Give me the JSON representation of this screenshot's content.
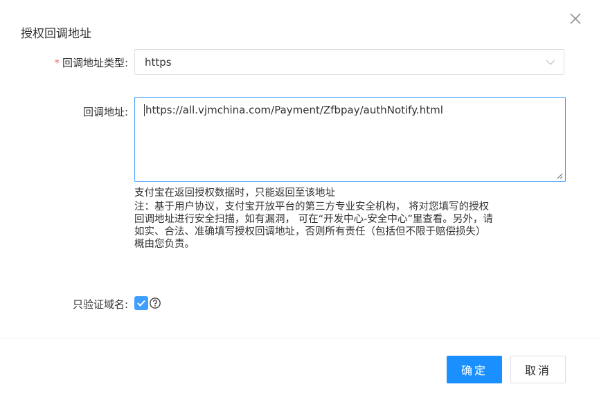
{
  "dialog": {
    "title": "授权回调地址"
  },
  "form": {
    "required_mark": "*",
    "type_label": "回调地址类型:",
    "type_value": "https",
    "address_label": "回调地址:",
    "address_value": "https://all.vjmchina.com/Payment/Zfbpay/authNotify.html",
    "hint_primary": "支付宝在返回授权数据时，只能返回至该地址",
    "hint_note_lines": [
      "注：基于用户协议，支付宝开放平台的第三方专业安全机构， 将对您填写的授权",
      "回调地址进行安全扫描，如有漏洞， 可在“开发中心-安全中心”里查看。另外，请",
      "如实、合法、准确填写授权回调地址，否则所有责任（包括但不限于赔偿损失）",
      "概由您负责。"
    ],
    "domain_only_label": "只验证域名:",
    "domain_only_checked": true
  },
  "footer": {
    "confirm_label": "确定",
    "cancel_label": "取消"
  },
  "colors": {
    "primary": "#1a8fff",
    "required": "#f56c6c",
    "focus_border": "#409eff"
  },
  "icons": {
    "close": "close-icon",
    "dropdown": "chevron-down-icon",
    "check": "check-icon",
    "help": "question-circle-icon"
  }
}
